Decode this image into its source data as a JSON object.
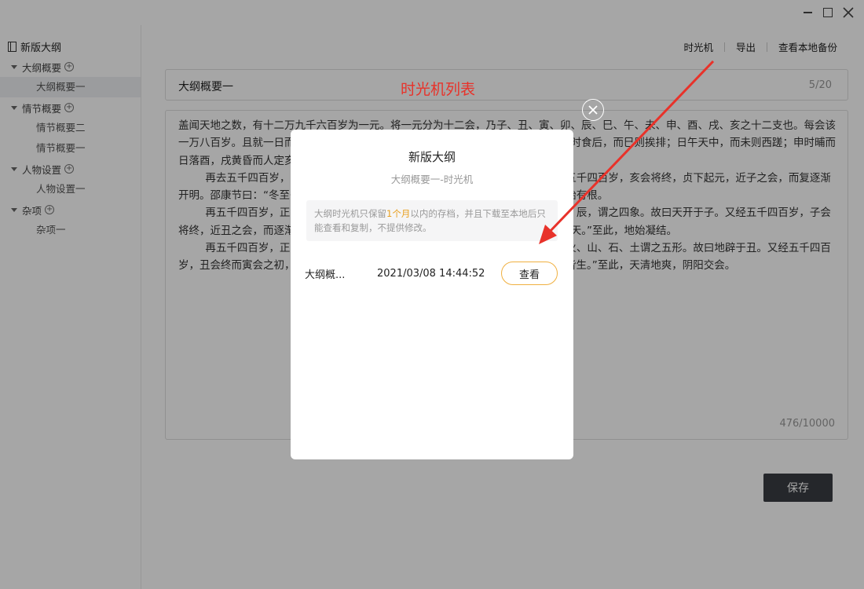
{
  "window": {
    "minimize_icon": "minimize-icon",
    "maximize_icon": "maximize-icon",
    "close_icon": "close-icon"
  },
  "sidebar": {
    "root_label": "新版大纲",
    "groups": [
      {
        "label": "大纲概要",
        "items": [
          "大纲概要一"
        ]
      },
      {
        "label": "情节概要",
        "items": [
          "情节概要二",
          "情节概要一"
        ]
      },
      {
        "label": "人物设置",
        "items": [
          "人物设置一"
        ]
      },
      {
        "label": "杂项",
        "items": [
          "杂项一"
        ]
      }
    ]
  },
  "toolbar": {
    "time_machine": "时光机",
    "export": "导出",
    "local_backup": "查看本地备份"
  },
  "editor": {
    "title": "大纲概要一",
    "title_count": "5/20",
    "content": "盖闻天地之数，有十二万九千六百岁为一元。将一元分为十二会，乃子、丑、寅、卯、辰、巳、午、未、申、酉、戌、亥之十二支也。每会该一万八百岁。且就一日而论：子时得阳气，而丑则鸡鸣；寅不通光，而卯则日出；辰时食后，而巳则挨排；日午天中，而未则西蹉；申时晡而日落酉，戌黄昏而人定亥。譬于大数，若到戌会之终，则天地昏蒙而万物否矣。\n        再去五千四百岁，交亥会之初，则当黑暗，而两间人物俱无矣，故曰混沌。又五千四百岁，亥会将终，贞下起元，近子之会，而复逐渐开明。邵康节曰：“冬至子之半，天心无改移。一阳初动处，万物未生时。”到此，天始有根。\n        再五千四百岁，正当子会，轻清上腾，有日，有月，有星，有辰。日、月、星、辰，谓之四象。故曰天开于子。又经五千四百岁，子会将终，近丑之会，而逐渐坚实。《易》曰：“大哉乾元！至哉坤元！万物资生，乃顺承天。”至此，地始凝结。\n        再五千四百岁，正当丑会，重浊下凝，有水，有火，有山，有石，有土。水、火、山、石、土谓之五形。故曰地辟于丑。又经五千四百岁，丑会终而寅会之初，发生万物。历曰：“天气下降，地气上升；天地交合，群物皆生。”至此，天清地爽，阴阳交会。",
    "content_count": "476/10000",
    "save_label": "保存"
  },
  "annotation": {
    "label": "时光机列表",
    "color": "#e8322a"
  },
  "modal": {
    "title": "新版大纲",
    "subtitle": "大纲概要一-时光机",
    "notice_prefix": "大纲时光机只保留",
    "notice_highlight": "1个月",
    "notice_suffix": "以内的存档，并且下载至本地后只能查看和复制，不提供修改。",
    "backups": [
      {
        "name": "大纲概...",
        "time": "2021/03/08 14:44:52",
        "action": "查看"
      }
    ],
    "close_icon": "close-circle-icon",
    "accent_color": "#f0b040"
  }
}
